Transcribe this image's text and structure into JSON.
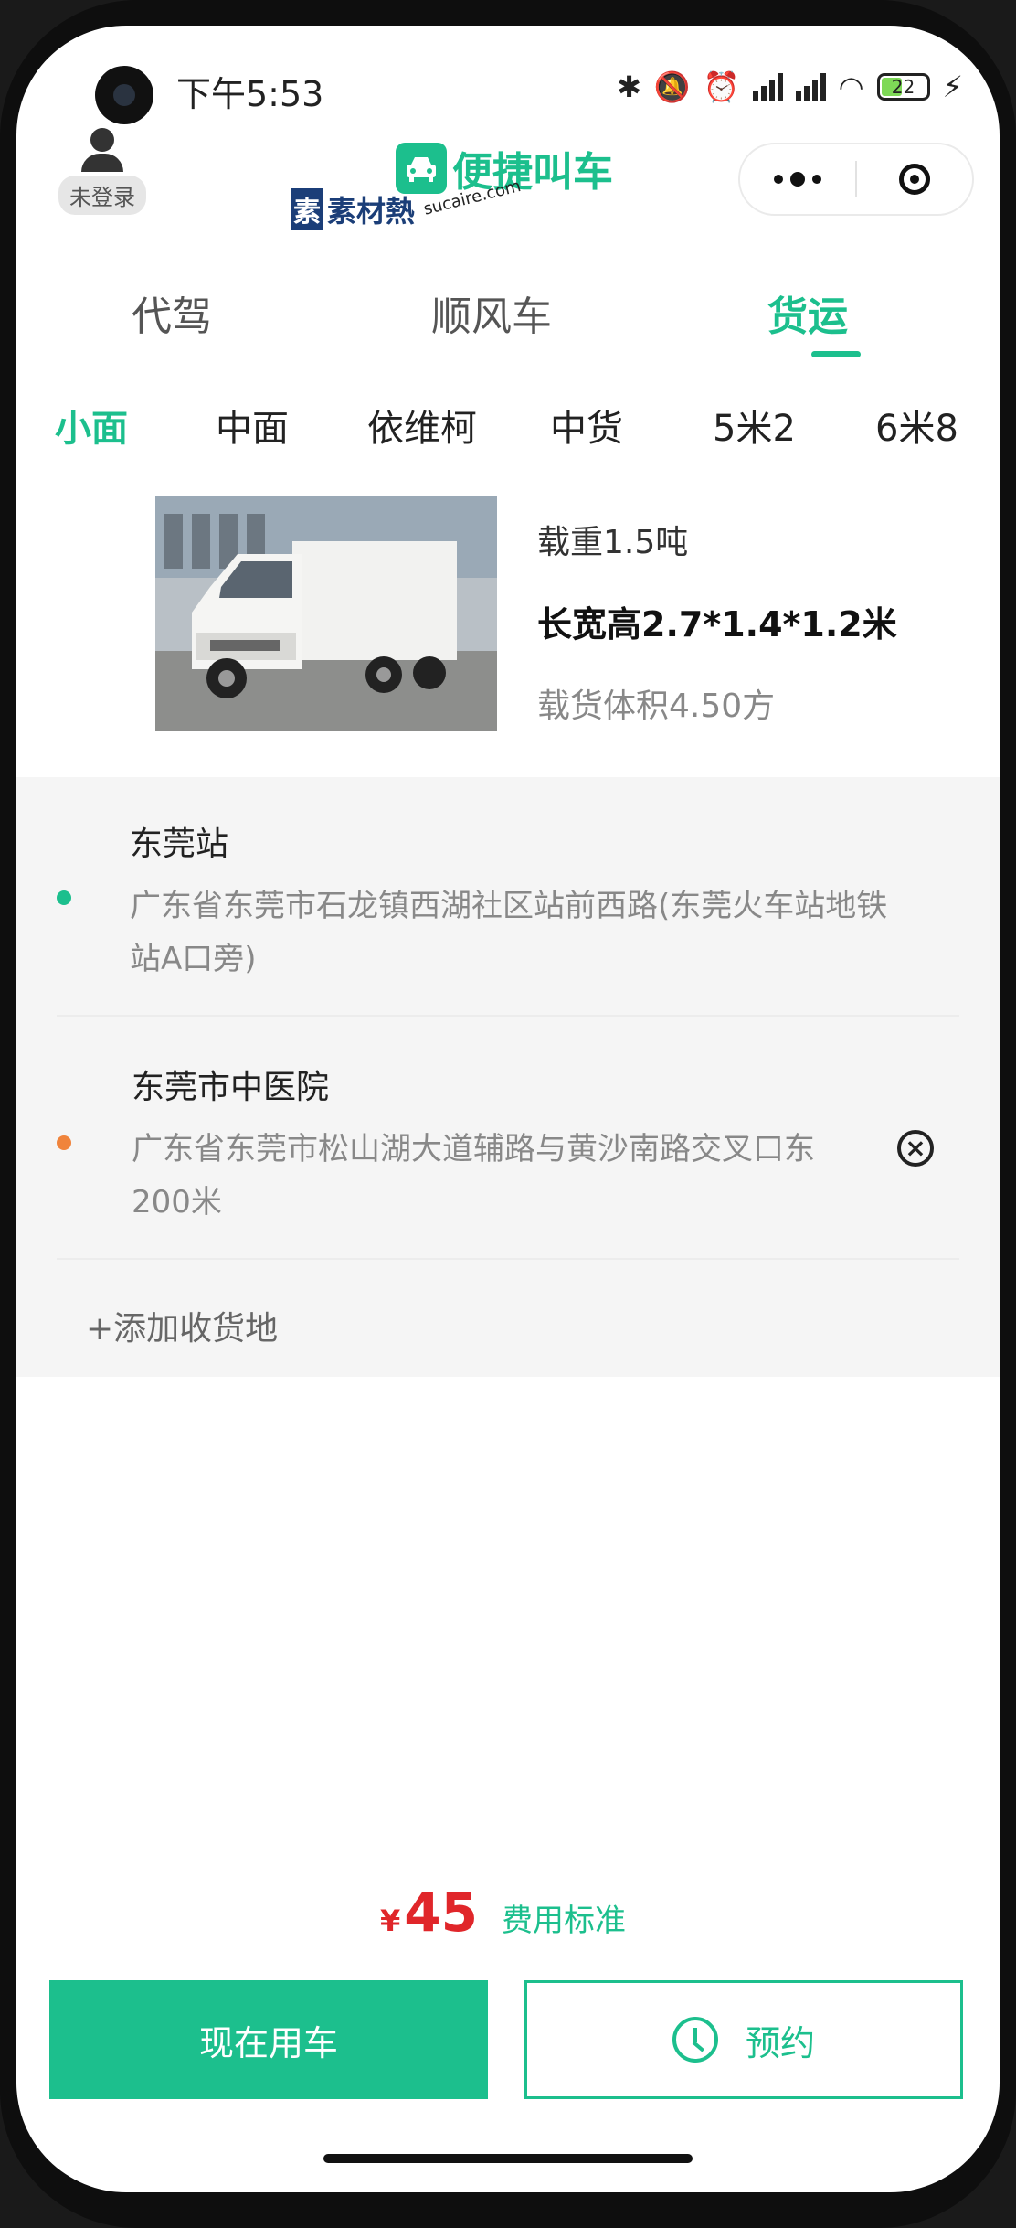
{
  "status_bar": {
    "time": "下午5:53",
    "battery": "22"
  },
  "header": {
    "login_label": "未登录",
    "app_name": "便捷叫车",
    "watermark_text": "素材熱",
    "watermark_logo": "素",
    "watermark_url": "sucaire.com"
  },
  "tabs": [
    {
      "label": "代驾"
    },
    {
      "label": "顺风车"
    },
    {
      "label": "货运",
      "active": true
    }
  ],
  "vehicle_types": [
    {
      "label": "小面",
      "active": true
    },
    {
      "label": "中面"
    },
    {
      "label": "依维柯"
    },
    {
      "label": "中货"
    },
    {
      "label": "5米2"
    },
    {
      "label": "6米8"
    }
  ],
  "vehicle": {
    "load": "载重1.5吨",
    "dimensions": "长宽高2.7*1.4*1.2米",
    "volume": "载货体积4.50方"
  },
  "route": {
    "origin": {
      "name": "东莞站",
      "address": "广东省东莞市石龙镇西湖社区站前西路(东莞火车站地铁站A口旁)",
      "dot_color": "#1cbf8d"
    },
    "destination": {
      "name": "东莞市中医院",
      "address": "广东省东莞市松山湖大道辅路与黄沙南路交叉口东200米",
      "dot_color": "#f0843c"
    },
    "add_label": "+添加收货地"
  },
  "fare": {
    "currency": "¥",
    "amount": "45",
    "standard_label": "费用标准"
  },
  "actions": {
    "now_label": "现在用车",
    "book_label": "预约"
  },
  "colors": {
    "accent": "#1cbf8d",
    "price": "#e0262a"
  }
}
